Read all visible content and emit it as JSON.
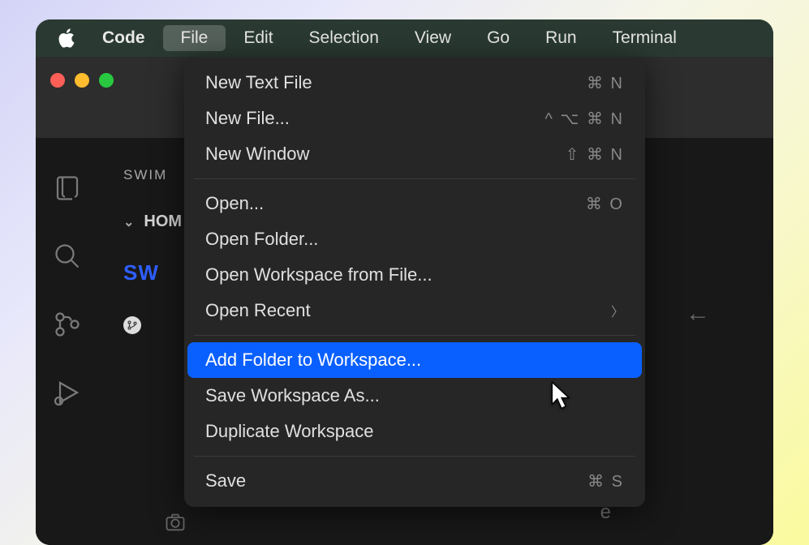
{
  "menubar": {
    "app_name": "Code",
    "items": [
      "File",
      "Edit",
      "Selection",
      "View",
      "Go",
      "Run",
      "Terminal"
    ],
    "active_index": 0
  },
  "sidebar": {
    "header": "SWIM",
    "folder": "HOM",
    "logo_text": "SW",
    "branch_partial": ""
  },
  "dropdown": {
    "items": [
      {
        "label": "New Text File",
        "shortcut": "⌘ N",
        "type": "item"
      },
      {
        "label": "New File...",
        "shortcut": "^ ⌥ ⌘ N",
        "type": "item"
      },
      {
        "label": "New Window",
        "shortcut": "⇧ ⌘ N",
        "type": "item"
      },
      {
        "type": "separator"
      },
      {
        "label": "Open...",
        "shortcut": "⌘ O",
        "type": "item"
      },
      {
        "label": "Open Folder...",
        "shortcut": "",
        "type": "item"
      },
      {
        "label": "Open Workspace from File...",
        "shortcut": "",
        "type": "item"
      },
      {
        "label": "Open Recent",
        "shortcut": "",
        "type": "submenu"
      },
      {
        "type": "separator"
      },
      {
        "label": "Add Folder to Workspace...",
        "shortcut": "",
        "type": "item",
        "highlighted": true
      },
      {
        "label": "Save Workspace As...",
        "shortcut": "",
        "type": "item"
      },
      {
        "label": "Duplicate Workspace",
        "shortcut": "",
        "type": "item"
      },
      {
        "type": "separator"
      },
      {
        "label": "Save",
        "shortcut": "⌘ S",
        "type": "item"
      }
    ]
  },
  "bottom_char": "e"
}
